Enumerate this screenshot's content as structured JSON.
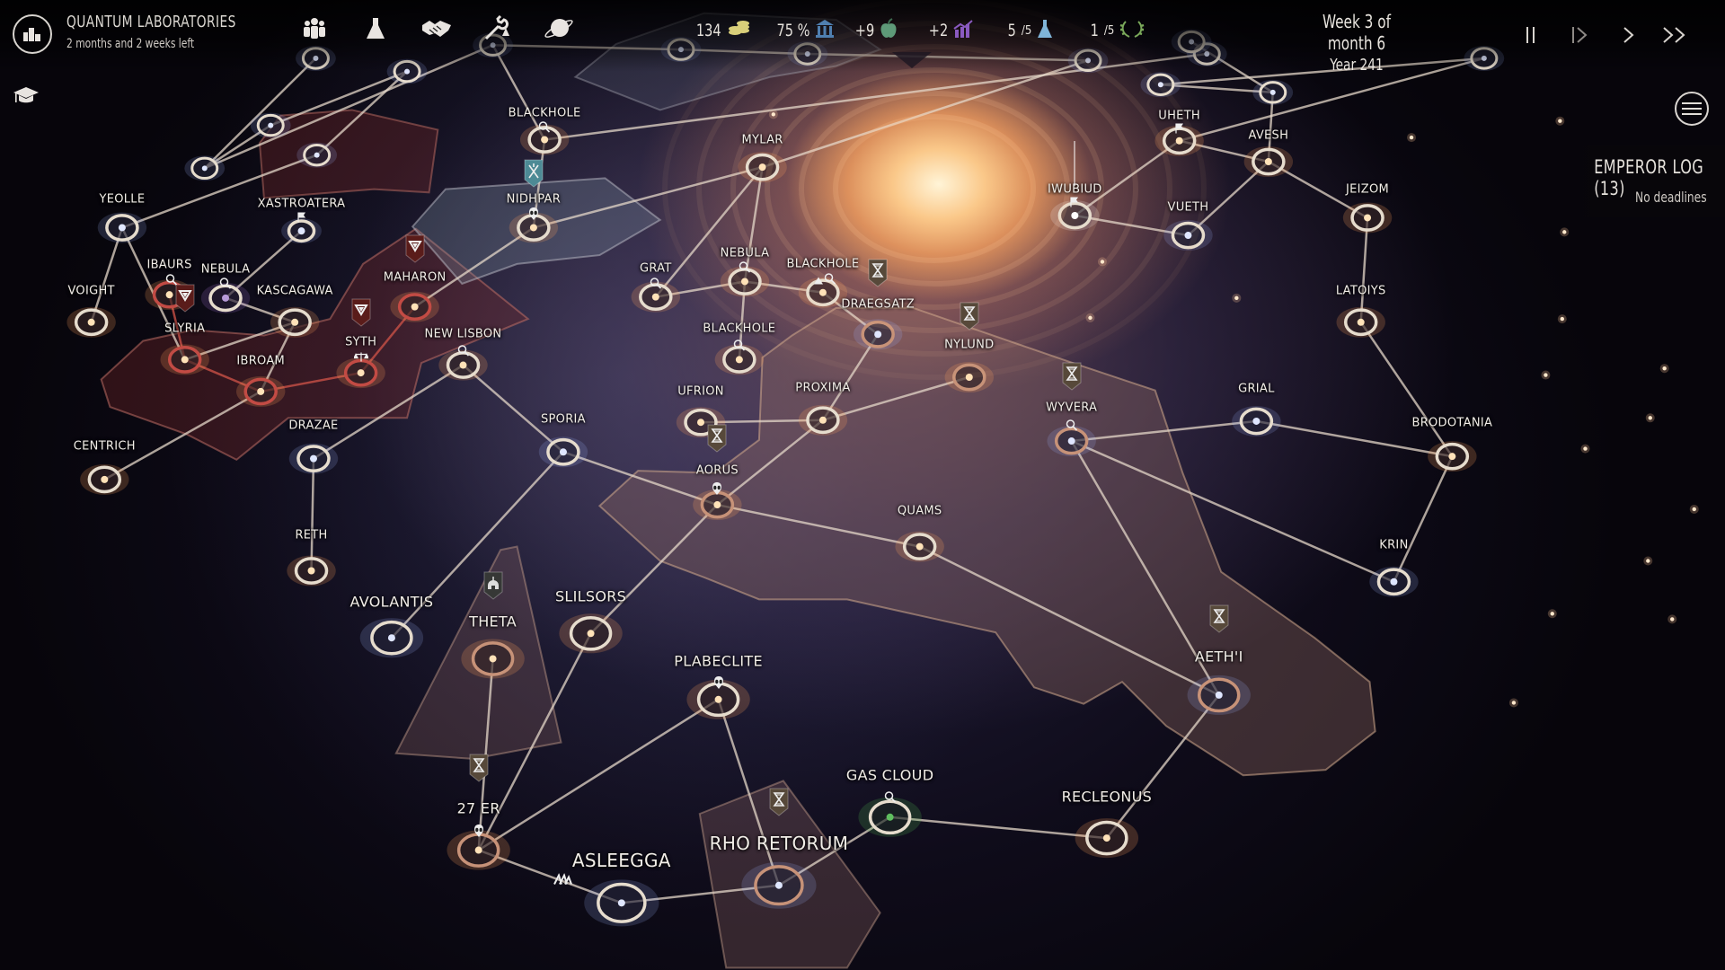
{
  "header": {
    "org_title": "QUANTUM LABORATORIES",
    "org_subtitle": "2 months and 2 weeks left",
    "org_icon": "city-skyline-icon",
    "education_icon": "graduation-cap-icon"
  },
  "categories": [
    {
      "name": "population",
      "icon": "people-icon"
    },
    {
      "name": "research",
      "icon": "flask-icon"
    },
    {
      "name": "diplomacy",
      "icon": "handshake-icon"
    },
    {
      "name": "construction",
      "icon": "wrench-ship-icon"
    },
    {
      "name": "planets",
      "icon": "planet-icon"
    }
  ],
  "resources": [
    {
      "value": "134",
      "suffix": "",
      "icon": "coins-icon",
      "color": "#d9cf7a"
    },
    {
      "value": "75 %",
      "suffix": "",
      "icon": "bank-icon",
      "color": "#4f7fb0"
    },
    {
      "value": "+9",
      "suffix": "",
      "icon": "apple-icon",
      "color": "#5e9a78"
    },
    {
      "value": "+2",
      "suffix": "",
      "icon": "growth-chart-icon",
      "color": "#8a5ac0"
    },
    {
      "value": "5",
      "suffix": "/5",
      "icon": "flask-blue-icon",
      "color": "#7fb4d8"
    },
    {
      "value": "1",
      "suffix": "/5",
      "icon": "laurel-icon",
      "color": "#7aa85a"
    }
  ],
  "date": {
    "week": "Week 3 of month 6",
    "year": "Year 241"
  },
  "time_controls": [
    {
      "name": "pause",
      "glyph": "||"
    },
    {
      "name": "step",
      "glyph": "|>"
    },
    {
      "name": "play",
      "glyph": ">"
    },
    {
      "name": "fast-forward",
      "glyph": ">>"
    }
  ],
  "emperor_log": {
    "title": "EMPEROR LOG (13)",
    "subtitle": "No deadlines"
  },
  "systems": [
    {
      "id": "blackhole1",
      "name": "BLACKHOLE",
      "type": "blackhole"
    },
    {
      "id": "nidhpar",
      "name": "NIDHPAR",
      "type": "star"
    },
    {
      "id": "mylar",
      "name": "MYLAR",
      "type": "star"
    },
    {
      "id": "yeolle",
      "name": "YEOLLE",
      "type": "star"
    },
    {
      "id": "xastroatera",
      "name": "XASTROATERA",
      "type": "star"
    },
    {
      "id": "ibaurs",
      "name": "IBAURS",
      "type": "star"
    },
    {
      "id": "nebula1",
      "name": "NEBULA",
      "type": "nebula"
    },
    {
      "id": "kascagawa",
      "name": "KASCAGAWA",
      "type": "star"
    },
    {
      "id": "voight",
      "name": "VOIGHT",
      "type": "star"
    },
    {
      "id": "slyria",
      "name": "SLYRIA",
      "type": "star"
    },
    {
      "id": "maharon",
      "name": "MAHARON",
      "type": "star"
    },
    {
      "id": "syth",
      "name": "SYTH",
      "type": "star"
    },
    {
      "id": "ibroam",
      "name": "IBROAM",
      "type": "star"
    },
    {
      "id": "newlisbon",
      "name": "NEW LISBON",
      "type": "star"
    },
    {
      "id": "centrich",
      "name": "CENTRICH",
      "type": "star"
    },
    {
      "id": "drazae",
      "name": "DRAZAE",
      "type": "star"
    },
    {
      "id": "reth",
      "name": "RETH",
      "type": "star"
    },
    {
      "id": "sporia",
      "name": "SPORIA",
      "type": "star"
    },
    {
      "id": "grat",
      "name": "GRAT",
      "type": "star"
    },
    {
      "id": "nebula2",
      "name": "NEBULA",
      "type": "nebula"
    },
    {
      "id": "blackhole2",
      "name": "BLACKHOLE",
      "type": "blackhole"
    },
    {
      "id": "blackhole3",
      "name": "BLACKHOLE",
      "type": "blackhole"
    },
    {
      "id": "draegsatz",
      "name": "DRAEGSATZ",
      "type": "star"
    },
    {
      "id": "nylund",
      "name": "NYLUND",
      "type": "star"
    },
    {
      "id": "ufrion",
      "name": "UFRION",
      "type": "star"
    },
    {
      "id": "proxima",
      "name": "PROXIMA",
      "type": "star"
    },
    {
      "id": "aorus",
      "name": "AORUS",
      "type": "star"
    },
    {
      "id": "quams",
      "name": "QUAMS",
      "type": "star"
    },
    {
      "id": "wyvera",
      "name": "WYVERA",
      "type": "star"
    },
    {
      "id": "grial",
      "name": "GRIAL",
      "type": "star"
    },
    {
      "id": "brodotania",
      "name": "BRODOTANIA",
      "type": "star"
    },
    {
      "id": "krin",
      "name": "KRIN",
      "type": "star"
    },
    {
      "id": "aethi",
      "name": "AETH'I",
      "type": "star"
    },
    {
      "id": "iwubiud",
      "name": "IWUBIUD",
      "type": "star"
    },
    {
      "id": "uheth",
      "name": "UHETH",
      "type": "star"
    },
    {
      "id": "avesh",
      "name": "AVESH",
      "type": "star"
    },
    {
      "id": "vueth",
      "name": "VUETH",
      "type": "star"
    },
    {
      "id": "jeizom",
      "name": "JEIZOM",
      "type": "star"
    },
    {
      "id": "latoiys",
      "name": "LATOIYS",
      "type": "star"
    },
    {
      "id": "avolantis",
      "name": "AVOLANTIS",
      "type": "star"
    },
    {
      "id": "theta",
      "name": "THETA",
      "type": "star"
    },
    {
      "id": "slilsors",
      "name": "SLILSORS",
      "type": "star"
    },
    {
      "id": "plabeclite",
      "name": "PLABECLITE",
      "type": "star"
    },
    {
      "id": "er27",
      "name": "27 ER",
      "type": "star"
    },
    {
      "id": "asleegga",
      "name": "ASLEEGGA",
      "type": "star"
    },
    {
      "id": "rhoretorum",
      "name": "RHO RETORUM",
      "type": "star"
    },
    {
      "id": "gascloud",
      "name": "GAS CLOUD",
      "type": "gascloud"
    },
    {
      "id": "recleonus",
      "name": "RECLEONUS",
      "type": "star"
    }
  ],
  "factions": [
    {
      "name": "red-faction",
      "color": "#7a2a2a",
      "emblem": "triangle-shield-icon"
    },
    {
      "name": "player-faction",
      "color": "#6a4a40",
      "emblem": "hourglass-banner-icon"
    },
    {
      "name": "teal-faction",
      "color": "#4d8a95",
      "emblem": "crossed-banner-icon"
    },
    {
      "name": "grey-faction",
      "color": "#3a3c3a",
      "emblem": "spartan-helmet-icon"
    }
  ]
}
